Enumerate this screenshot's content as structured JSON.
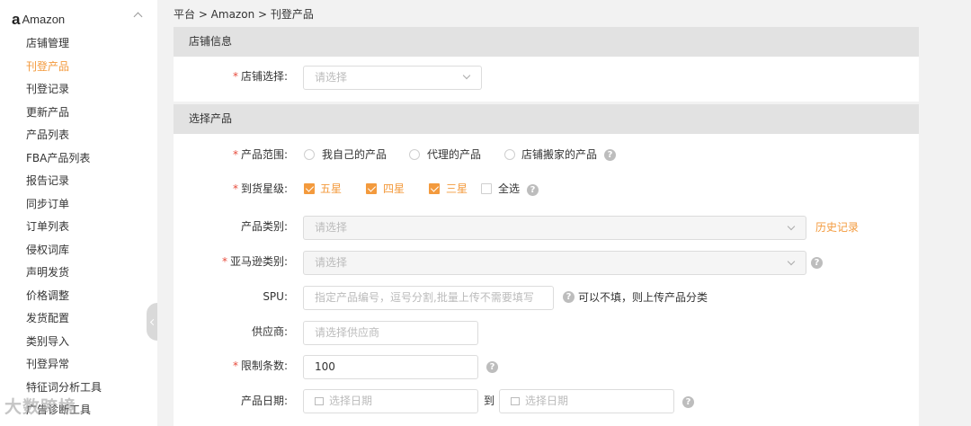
{
  "sidebar": {
    "logo": "a",
    "title": "Amazon",
    "items": [
      {
        "label": "店铺管理",
        "active": false
      },
      {
        "label": "刊登产品",
        "active": true
      },
      {
        "label": "刊登记录",
        "active": false
      },
      {
        "label": "更新产品",
        "active": false
      },
      {
        "label": "产品列表",
        "active": false
      },
      {
        "label": "FBA产品列表",
        "active": false
      },
      {
        "label": "报告记录",
        "active": false
      },
      {
        "label": "同步订单",
        "active": false
      },
      {
        "label": "订单列表",
        "active": false
      },
      {
        "label": "侵权词库",
        "active": false
      },
      {
        "label": "声明发货",
        "active": false
      },
      {
        "label": "价格调整",
        "active": false
      },
      {
        "label": "发货配置",
        "active": false
      },
      {
        "label": "类别导入",
        "active": false
      },
      {
        "label": "刊登异常",
        "active": false
      },
      {
        "label": "特征词分析工具",
        "active": false
      },
      {
        "label": "广告诊断工具",
        "active": false
      }
    ],
    "watermark": "大数跨境"
  },
  "breadcrumb": "平台 > Amazon > 刊登产品",
  "store_section": {
    "title": "店铺信息",
    "store_select": {
      "label": "店铺选择:",
      "required": true,
      "placeholder": "请选择"
    }
  },
  "product_section": {
    "title": "选择产品",
    "scope": {
      "label": "产品范围:",
      "required": true,
      "options": [
        "我自己的产品",
        "代理的产品",
        "店铺搬家的产品"
      ]
    },
    "stars": {
      "label": "到货星级:",
      "required": true,
      "options": [
        {
          "label": "五星",
          "checked": true
        },
        {
          "label": "四星",
          "checked": true
        },
        {
          "label": "三星",
          "checked": true
        },
        {
          "label": "全选",
          "checked": false
        }
      ]
    },
    "category": {
      "label": "产品类别:",
      "required": false,
      "placeholder": "请选择",
      "history_link": "历史记录"
    },
    "amazon_category": {
      "label": "亚马逊类别:",
      "required": true,
      "placeholder": "请选择"
    },
    "spu": {
      "label": "SPU:",
      "placeholder": "指定产品编号，逗号分割,批量上传不需要填写",
      "hint": "可以不填，则上传产品分类"
    },
    "supplier": {
      "label": "供应商:",
      "placeholder": "请选择供应商"
    },
    "limit": {
      "label": "限制条数:",
      "required": true,
      "value": "100"
    },
    "date": {
      "label": "产品日期:",
      "start_placeholder": "选择日期",
      "to": "到",
      "end_placeholder": "选择日期"
    }
  },
  "colors": {
    "accent": "#f39a3d",
    "required": "#e74c3c",
    "section_bg": "#e2e2e2"
  }
}
